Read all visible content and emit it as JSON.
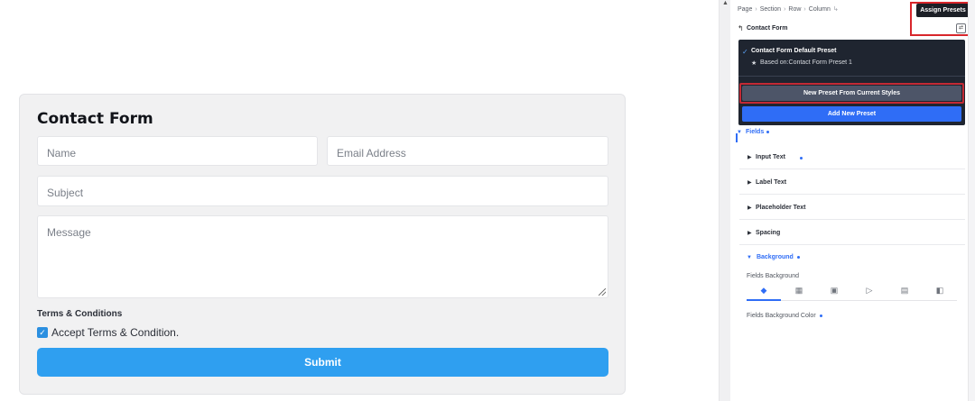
{
  "form": {
    "title": "Contact Form",
    "name_placeholder": "Name",
    "email_placeholder": "Email Address",
    "subject_placeholder": "Subject",
    "message_placeholder": "Message",
    "terms_label": "Terms & Conditions",
    "checkbox_label": "Accept Terms & Condition.",
    "checkbox_checked": true,
    "submit_label": "Submit"
  },
  "panel": {
    "breadcrumb": [
      "Page",
      "Section",
      "Row",
      "Column"
    ],
    "element_title": "Contact Form",
    "tooltip": "Assign Presets",
    "dropdown": {
      "current_preset": "Contact Form Default Preset",
      "based_on": "Based on:Contact Form Preset 1",
      "new_preset_btn": "New Preset From Current Styles",
      "add_preset_btn": "Add New Preset"
    },
    "fields_heading": "Fields",
    "groups": [
      "Input Text",
      "Label Text",
      "Placeholder Text",
      "Spacing"
    ],
    "background_heading": "Background",
    "fields_background_label": "Fields Background",
    "bg_tabs": [
      "color-fill-icon",
      "gradient-icon",
      "image-icon",
      "video-icon",
      "pattern-icon",
      "mask-icon"
    ],
    "fields_bg_color_label": "Fields Background Color"
  },
  "colors": {
    "accent": "#2f6df6",
    "submit": "#2f9ff0",
    "highlight": "#d8262b"
  }
}
